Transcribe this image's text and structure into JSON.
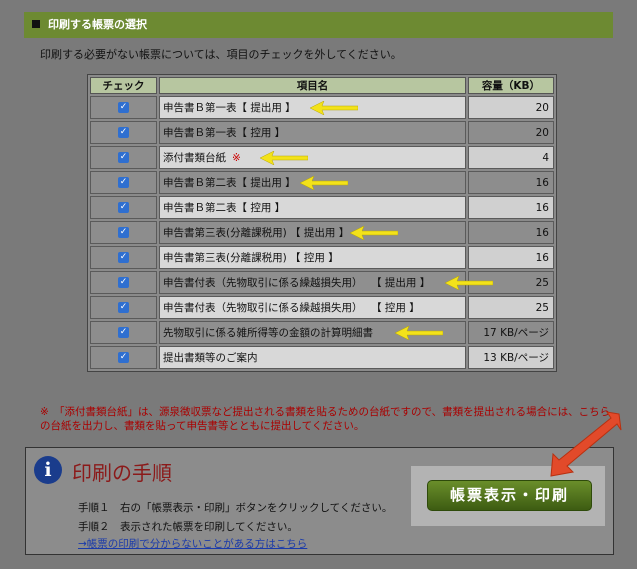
{
  "section": {
    "title": "印刷する帳票の選択"
  },
  "intro": "印刷する必要がない帳票については、項目のチェックを外してください。",
  "table": {
    "headers": {
      "check": "チェック",
      "name": "項目名",
      "size": "容量（KB）"
    },
    "rows": [
      {
        "name": "申告書Ｂ第一表【 提出用 】",
        "size": "20",
        "mark": ""
      },
      {
        "name": "申告書Ｂ第一表【 控用 】",
        "size": "20",
        "mark": ""
      },
      {
        "name": "添付書類台紙",
        "size": "4",
        "mark": "※"
      },
      {
        "name": "申告書Ｂ第二表【 提出用 】",
        "size": "16",
        "mark": ""
      },
      {
        "name": "申告書Ｂ第二表【 控用 】",
        "size": "16",
        "mark": ""
      },
      {
        "name": "申告書第三表(分離課税用) 【 提出用 】",
        "size": "16",
        "mark": ""
      },
      {
        "name": "申告書第三表(分離課税用) 【 控用 】",
        "size": "16",
        "mark": ""
      },
      {
        "name": "申告書付表（先物取引に係る繰越損失用）　 【 提出用 】",
        "size": "25",
        "mark": ""
      },
      {
        "name": "申告書付表（先物取引に係る繰越損失用）　 【 控用 】",
        "size": "25",
        "mark": ""
      },
      {
        "name": "先物取引に係る雑所得等の金額の計算明細書",
        "size": "17 KB/ページ",
        "mark": ""
      },
      {
        "name": "提出書類等のご案内",
        "size": "13 KB/ページ",
        "mark": ""
      }
    ]
  },
  "note": "※　「添付書類台紙」は、源泉徴収票など提出される書類を貼るための台紙ですので、書類を提出される場合には、こちらの台紙を出力し、書類を貼って申告書等とともに提出してください。",
  "procedure": {
    "icon": "info-icon",
    "title": "印刷の手順",
    "step1": "手順１　右の「帳票表示・印刷」ボタンをクリックしてください。",
    "step2": "手順２　表示された帳票を印刷してください。",
    "help_link": "→帳票の印刷で分からないことがある方はこちら",
    "print_button": "帳票表示・印刷"
  },
  "colors": {
    "header_green": "#6d8a32",
    "arrow_yellow": "#f3e21a",
    "big_arrow": "#e24a2a",
    "checkbox_blue": "#2f6fd0"
  }
}
